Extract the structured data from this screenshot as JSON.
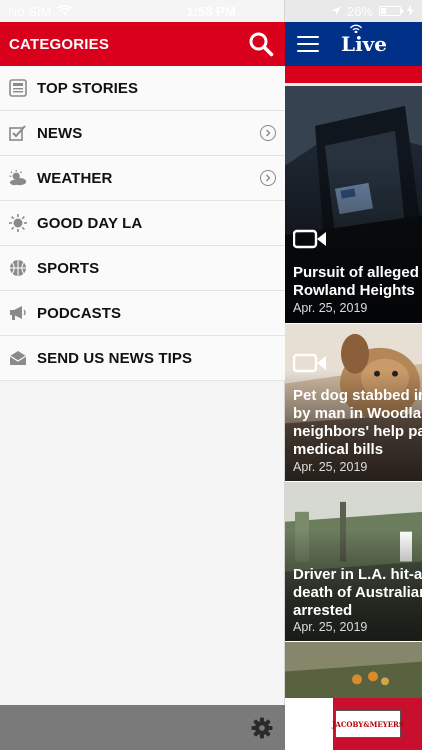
{
  "status": {
    "carrier": "No SIM",
    "time": "1:58 PM",
    "battery_text": "26%",
    "battery_level": 0.26
  },
  "drawer": {
    "title": "CATEGORIES",
    "items": [
      {
        "label": "TOP STORIES",
        "icon": "newspaper-icon",
        "has_chevron": false
      },
      {
        "label": "NEWS",
        "icon": "checkbox-pencil-icon",
        "has_chevron": true
      },
      {
        "label": "WEATHER",
        "icon": "sun-cloud-icon",
        "has_chevron": true
      },
      {
        "label": "GOOD DAY LA",
        "icon": "sun-icon",
        "has_chevron": false
      },
      {
        "label": "SPORTS",
        "icon": "basketball-icon",
        "has_chevron": false
      },
      {
        "label": "PODCASTS",
        "icon": "megaphone-icon",
        "has_chevron": false
      },
      {
        "label": "SEND US NEWS TIPS",
        "icon": "envelope-icon",
        "has_chevron": false
      }
    ]
  },
  "main": {
    "brand": "Live",
    "stories": [
      {
        "headline": "Pursuit of alleged c\nRowland Heights",
        "date": "Apr. 25, 2019",
        "has_video": true
      },
      {
        "headline": "Pet dog stabbed in\nby man in Woodlan\nneighbors' help pa\nmedical bills",
        "date": "Apr. 25, 2019",
        "has_video": true
      },
      {
        "headline": "Driver in L.A. hit-an\ndeath of Australian\narrested",
        "date": "Apr. 25, 2019",
        "has_video": false
      }
    ],
    "ad_brand": "JACOBY&MEYERS"
  },
  "colors": {
    "drawer_red": "#d9001b",
    "nav_blue": "#003087",
    "footer_gray": "#7a7a7a"
  }
}
